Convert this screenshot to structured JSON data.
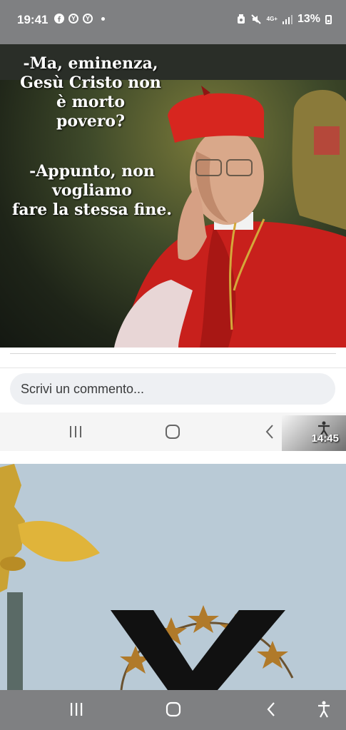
{
  "status_bar": {
    "time": "19:41",
    "battery_percent": "13%",
    "network_label": "4G+",
    "icons": [
      "facebook-icon",
      "y-circle-icon",
      "y-circle-icon",
      "notification-dot",
      "alarm-icon",
      "mute-icon",
      "signal-icon",
      "battery-icon"
    ]
  },
  "meme": {
    "line1": [
      "-Ma, eminenza,",
      "Gesù Cristo non",
      "è morto",
      "povero?"
    ],
    "line2": [
      "-Appunto, non",
      "vogliamo",
      "fare la stessa fine."
    ]
  },
  "comment": {
    "placeholder": "Scrivi un commento..."
  },
  "inner_nav": {
    "timestamp": "14:45",
    "icons": [
      "recent-apps-icon",
      "home-icon",
      "back-icon",
      "accessibility-icon"
    ]
  },
  "bottom_nav": {
    "icons": [
      "recent-apps-icon",
      "home-icon",
      "back-icon",
      "accessibility-icon"
    ]
  }
}
